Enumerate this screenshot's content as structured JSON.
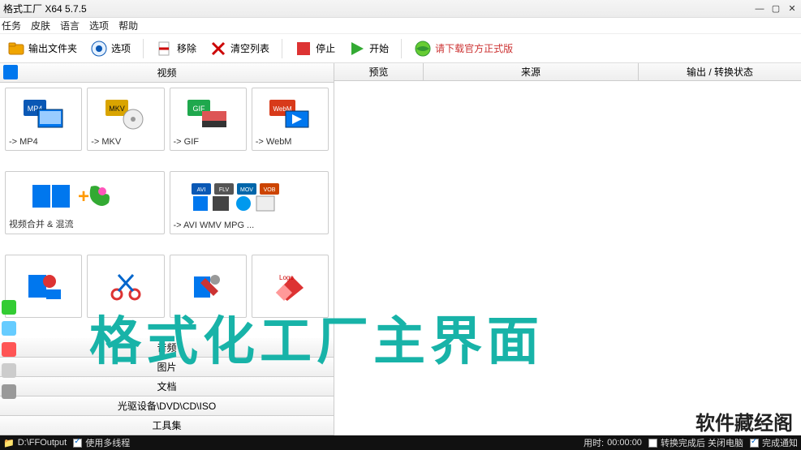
{
  "window": {
    "title": "格式工厂 X64 5.7.5"
  },
  "menu": [
    "任务",
    "皮肤",
    "语言",
    "选项",
    "帮助"
  ],
  "toolbar": {
    "output_folder": "输出文件夹",
    "options": "选项",
    "remove": "移除",
    "clear_list": "清空列表",
    "stop": "停止",
    "start": "开始",
    "download_link": "请下载官方正式版"
  },
  "categories": {
    "video": "视频",
    "audio": "音频",
    "picture": "图片",
    "document": "文档",
    "optical": "光驱设备\\DVD\\CD\\ISO",
    "toolbox": "工具集"
  },
  "video_cards": [
    {
      "label": "-> MP4",
      "badge": "MP4",
      "badge_color": "#0a58b5"
    },
    {
      "label": "-> MKV",
      "badge": "MKV",
      "badge_color": "#d9a400"
    },
    {
      "label": "-> GIF",
      "badge": "GIF",
      "badge_color": "#1fa84d"
    },
    {
      "label": "-> WebM",
      "badge": "WebM",
      "badge_color": "#d83a1a"
    },
    {
      "label": "视频合并 & 混流",
      "wide": 2
    },
    {
      "label": "-> AVI WMV MPG ...",
      "wide": 2
    }
  ],
  "tabs": {
    "preview": "预览",
    "source": "来源",
    "output": "输出 / 转换状态"
  },
  "status": {
    "path_icon": "folder",
    "path": "D:\\FFOutput",
    "multithread": "使用多线程",
    "elapsed_label": "用时:",
    "elapsed": "00:00:00",
    "shutdown": "转换完成后 关闭电脑",
    "notify": "完成通知"
  },
  "overlay_text": "格式化工厂主界面",
  "watermark": "软件藏经阁"
}
